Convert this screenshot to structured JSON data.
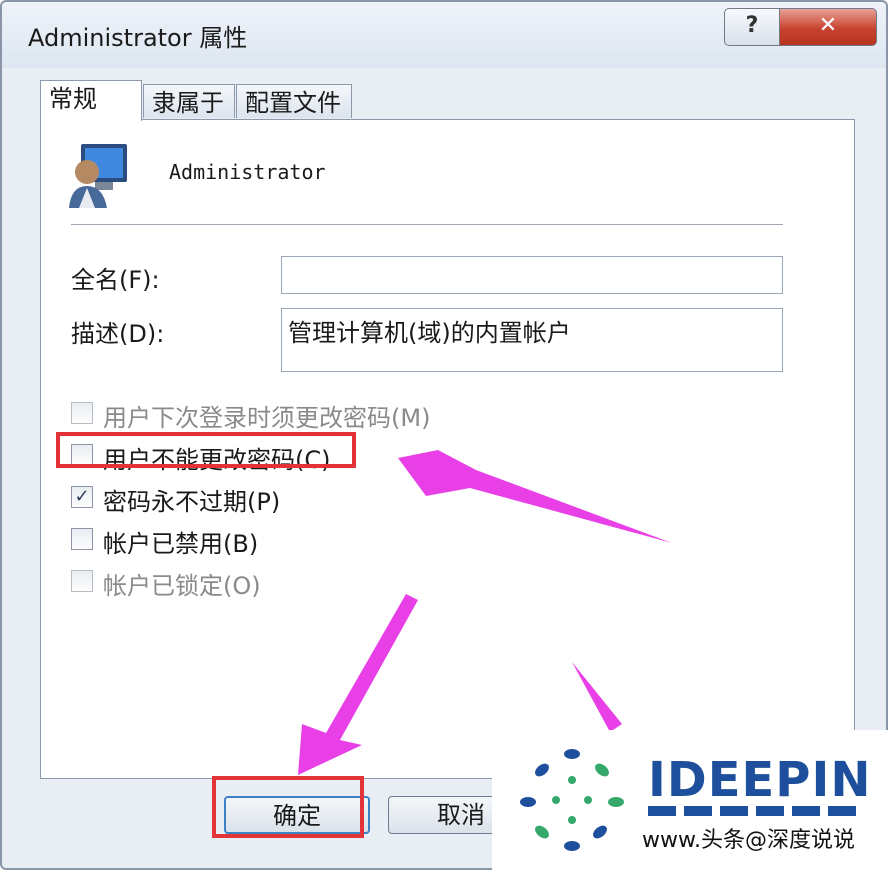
{
  "window": {
    "title": "Administrator 属性",
    "help_label": "?",
    "close_label": "✕"
  },
  "tabs": [
    {
      "label": "常规",
      "active": true
    },
    {
      "label": "隶属于",
      "active": false
    },
    {
      "label": "配置文件",
      "active": false
    }
  ],
  "general": {
    "user_name": "Administrator",
    "fullname_label": "全名(F):",
    "fullname_value": "",
    "description_label": "描述(D):",
    "description_value": "管理计算机(域)的内置帐户",
    "checkboxes": [
      {
        "label": "用户下次登录时须更改密码(M)",
        "checked": false,
        "enabled": false
      },
      {
        "label": "用户不能更改密码(C)",
        "checked": false,
        "enabled": true
      },
      {
        "label": "密码永不过期(P)",
        "checked": true,
        "enabled": true
      },
      {
        "label": "帐户已禁用(B)",
        "checked": false,
        "enabled": true
      },
      {
        "label": "帐户已锁定(O)",
        "checked": false,
        "enabled": false
      }
    ]
  },
  "buttons": {
    "ok": "确定",
    "cancel": "取消"
  },
  "icons": {
    "user_icon": "user-computer-icon",
    "check_mark": "✓"
  },
  "annotations": {
    "highlight_color": "#e23438",
    "arrow_color": "#e840e6"
  },
  "watermark": {
    "logo_text": "IDEEPIN",
    "url_text": "www.头条@深度说说"
  }
}
